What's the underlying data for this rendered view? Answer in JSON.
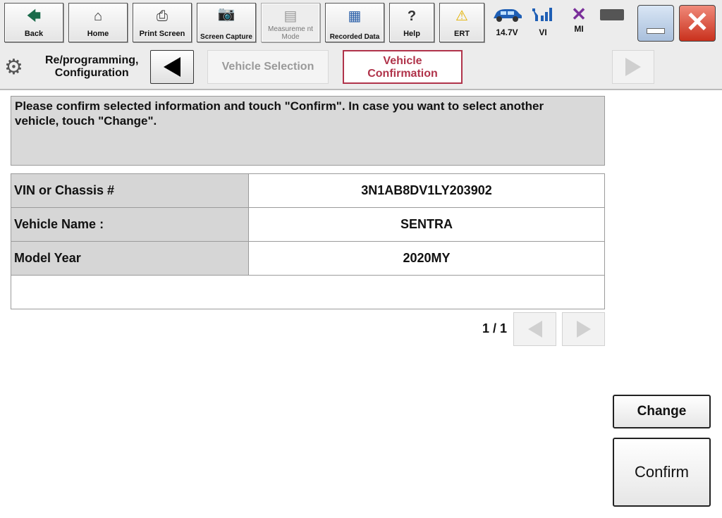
{
  "toolbar": {
    "buttons": [
      {
        "label": "Back",
        "icon": "back-arrow-icon"
      },
      {
        "label": "Home",
        "icon": "home-icon"
      },
      {
        "label": "Print Screen",
        "icon": "printer-icon"
      },
      {
        "label": "Screen Capture",
        "icon": "camera-icon"
      },
      {
        "label": "Measureme nt Mode",
        "icon": "measurement-icon"
      },
      {
        "label": "Recorded Data",
        "icon": "recorded-data-icon"
      },
      {
        "label": "Help",
        "icon": "help-icon"
      },
      {
        "label": "ERT",
        "icon": "warning-icon"
      }
    ],
    "status": {
      "voltage": "14.7V",
      "vi": "VI",
      "mi": "MI"
    }
  },
  "nav": {
    "root_line1": "Re/programming,",
    "root_line2": "Configuration",
    "crumb_vehicle_selection": "Vehicle Selection",
    "crumb_vehicle_confirmation_line1": "Vehicle",
    "crumb_vehicle_confirmation_line2": "Confirmation"
  },
  "message": {
    "line1": "Please confirm selected information and touch \"Confirm\". In case you want to select another",
    "line2": "vehicle, touch \"Change\"."
  },
  "info_table": [
    {
      "key": "VIN or Chassis #",
      "value": "3N1AB8DV1LY203902"
    },
    {
      "key": "Vehicle Name :",
      "value": "SENTRA"
    },
    {
      "key": "Model Year",
      "value": "2020MY"
    }
  ],
  "pager": {
    "text": "1 / 1"
  },
  "actions": {
    "change": "Change",
    "confirm": "Confirm"
  },
  "colors": {
    "accent": "#b0334a",
    "close": "#c9311d",
    "status_blue": "#1f5fb5",
    "mi_purple": "#7a2f9a"
  }
}
